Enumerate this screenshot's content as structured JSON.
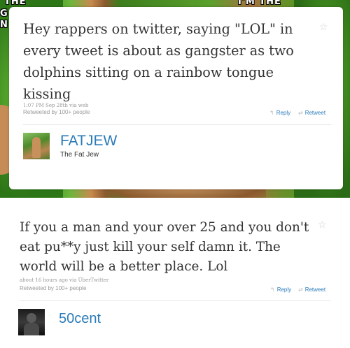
{
  "meme": {
    "text_top_left": "THE",
    "text_g": "G",
    "text_n": "N",
    "text_top_right": "I'M THE"
  },
  "tweets": [
    {
      "text": "Hey rappers on twitter, saying \"LOL\" in every tweet is about as gangster as two dolphins sitting on a rainbow tongue kissing",
      "meta": "1:07 PM Sep 28th via web",
      "retweeted_by": "Retweeted by 100+ people",
      "reply_label": "Reply",
      "retweet_label": "Retweet",
      "screen_name": "FATJEW",
      "real_name": "The Fat Jew"
    },
    {
      "text": "If you a man and your over 25 and you don't eat pu**y just kill your self damn it. The world will be a better place. Lol",
      "meta": "about 16 hours ago via ÜberTwitter",
      "retweeted_by": "Retweeted by 100+ people",
      "reply_label": "Reply",
      "retweet_label": "Retweet",
      "screen_name": "50cent"
    }
  ],
  "icons": {
    "favorite": "star-icon",
    "reply": "reply-arrow-icon",
    "retweet": "retweet-icon"
  },
  "colors": {
    "link": "#2b7bb9",
    "text": "#333333",
    "muted": "#999999"
  }
}
